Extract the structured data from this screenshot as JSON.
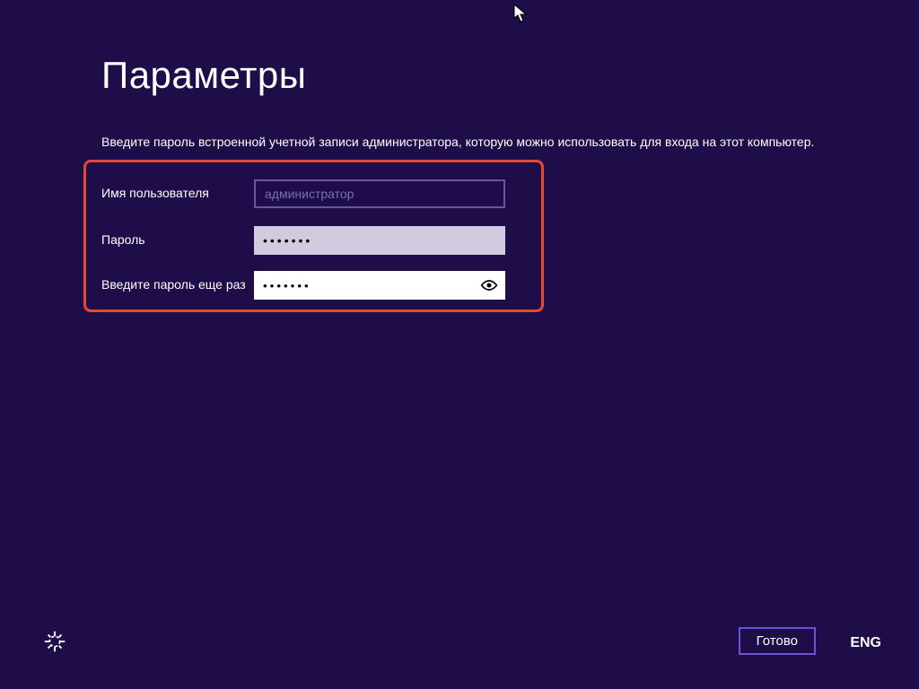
{
  "header": {
    "title": "Параметры"
  },
  "description": "Введите пароль встроенной учетной записи администратора, которую можно использовать для входа на этот компьютер.",
  "form": {
    "username": {
      "label": "Имя пользователя",
      "placeholder": "администратор",
      "value": ""
    },
    "password": {
      "label": "Пароль",
      "value": "•••••••"
    },
    "confirm": {
      "label": "Введите пароль еще раз",
      "value": "•••••••"
    }
  },
  "footer": {
    "done_label": "Готово",
    "language": "ENG"
  },
  "icons": {
    "ease_of_access": "ease-of-access-icon",
    "reveal": "eye-icon"
  }
}
